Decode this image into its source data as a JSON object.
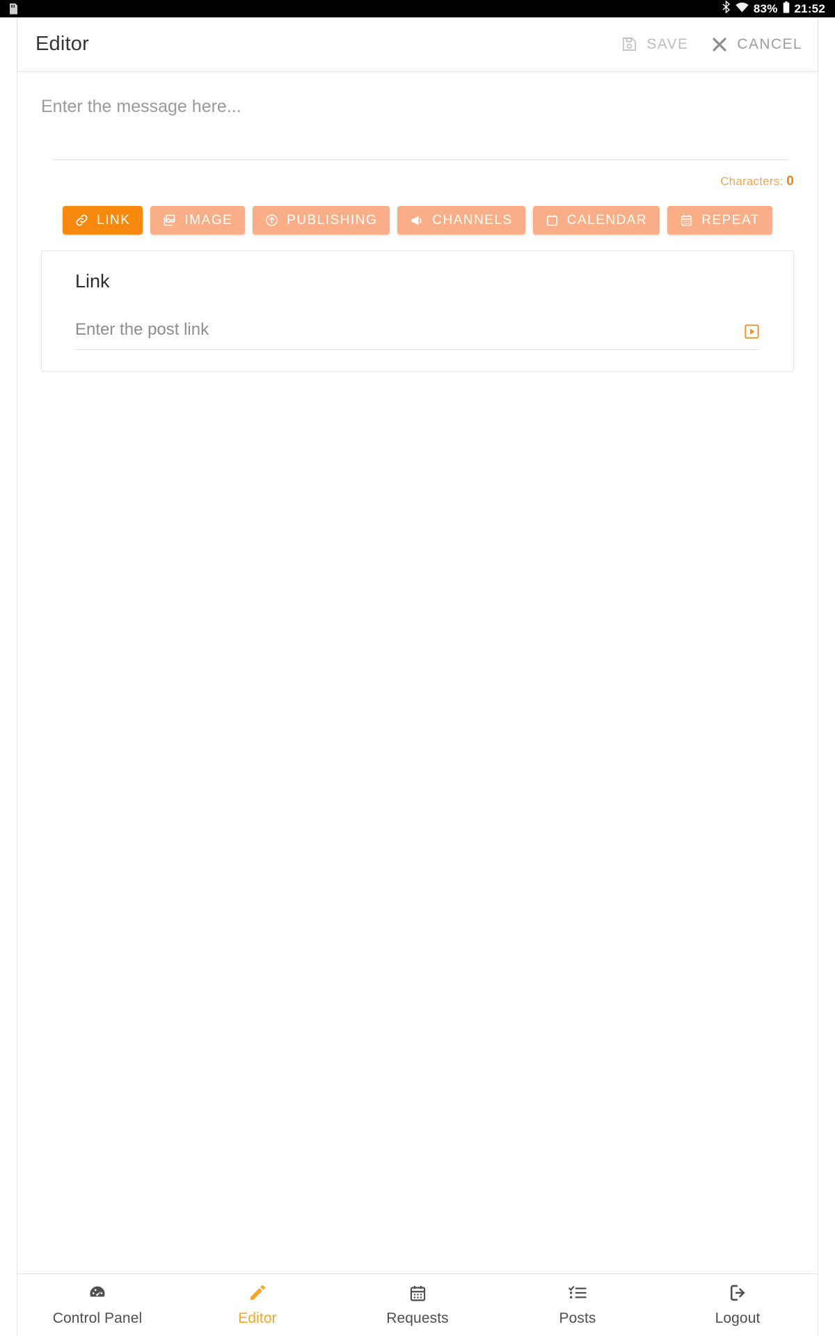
{
  "statusbar": {
    "sd_icon": "sd-card-icon",
    "bluetooth_icon": "bluetooth-icon",
    "wifi_icon": "wifi-icon",
    "battery_percent": "83%",
    "battery_icon": "battery-icon",
    "time": "21:52"
  },
  "header": {
    "title": "Editor",
    "save_label": "SAVE",
    "save_icon": "floppy-disk-icon",
    "cancel_label": "CANCEL",
    "cancel_icon": "close-x-icon"
  },
  "message": {
    "placeholder": "Enter the message here...",
    "value": "",
    "counter_label": "Characters:",
    "counter_value": "0"
  },
  "tabs": [
    {
      "label": "LINK",
      "icon": "chain-link-icon",
      "active": true
    },
    {
      "label": "IMAGE",
      "icon": "photos-icon",
      "active": false
    },
    {
      "label": "PUBLISHING",
      "icon": "upload-circle-icon",
      "active": false
    },
    {
      "label": "CHANNELS",
      "icon": "megaphone-icon",
      "active": false
    },
    {
      "label": "CALENDAR",
      "icon": "calendar-icon",
      "active": false
    },
    {
      "label": "REPEAT",
      "icon": "calendar-dots-icon",
      "active": false
    }
  ],
  "link_card": {
    "title": "Link",
    "field_placeholder": "Enter the post link",
    "field_value": "",
    "action_icon": "play-square-icon"
  },
  "bottom_nav": [
    {
      "label": "Control Panel",
      "icon": "gauge-icon",
      "active": false
    },
    {
      "label": "Editor",
      "icon": "pencil-icon",
      "active": true
    },
    {
      "label": "Requests",
      "icon": "calendar-dots-icon",
      "active": false
    },
    {
      "label": "Posts",
      "icon": "checklist-icon",
      "active": false
    },
    {
      "label": "Logout",
      "icon": "exit-icon",
      "active": false
    }
  ],
  "colors": {
    "accent": "#f5880d",
    "accent_light": "#f9ae87",
    "counter": "#f0a64a",
    "nav_active": "#f5a623"
  }
}
